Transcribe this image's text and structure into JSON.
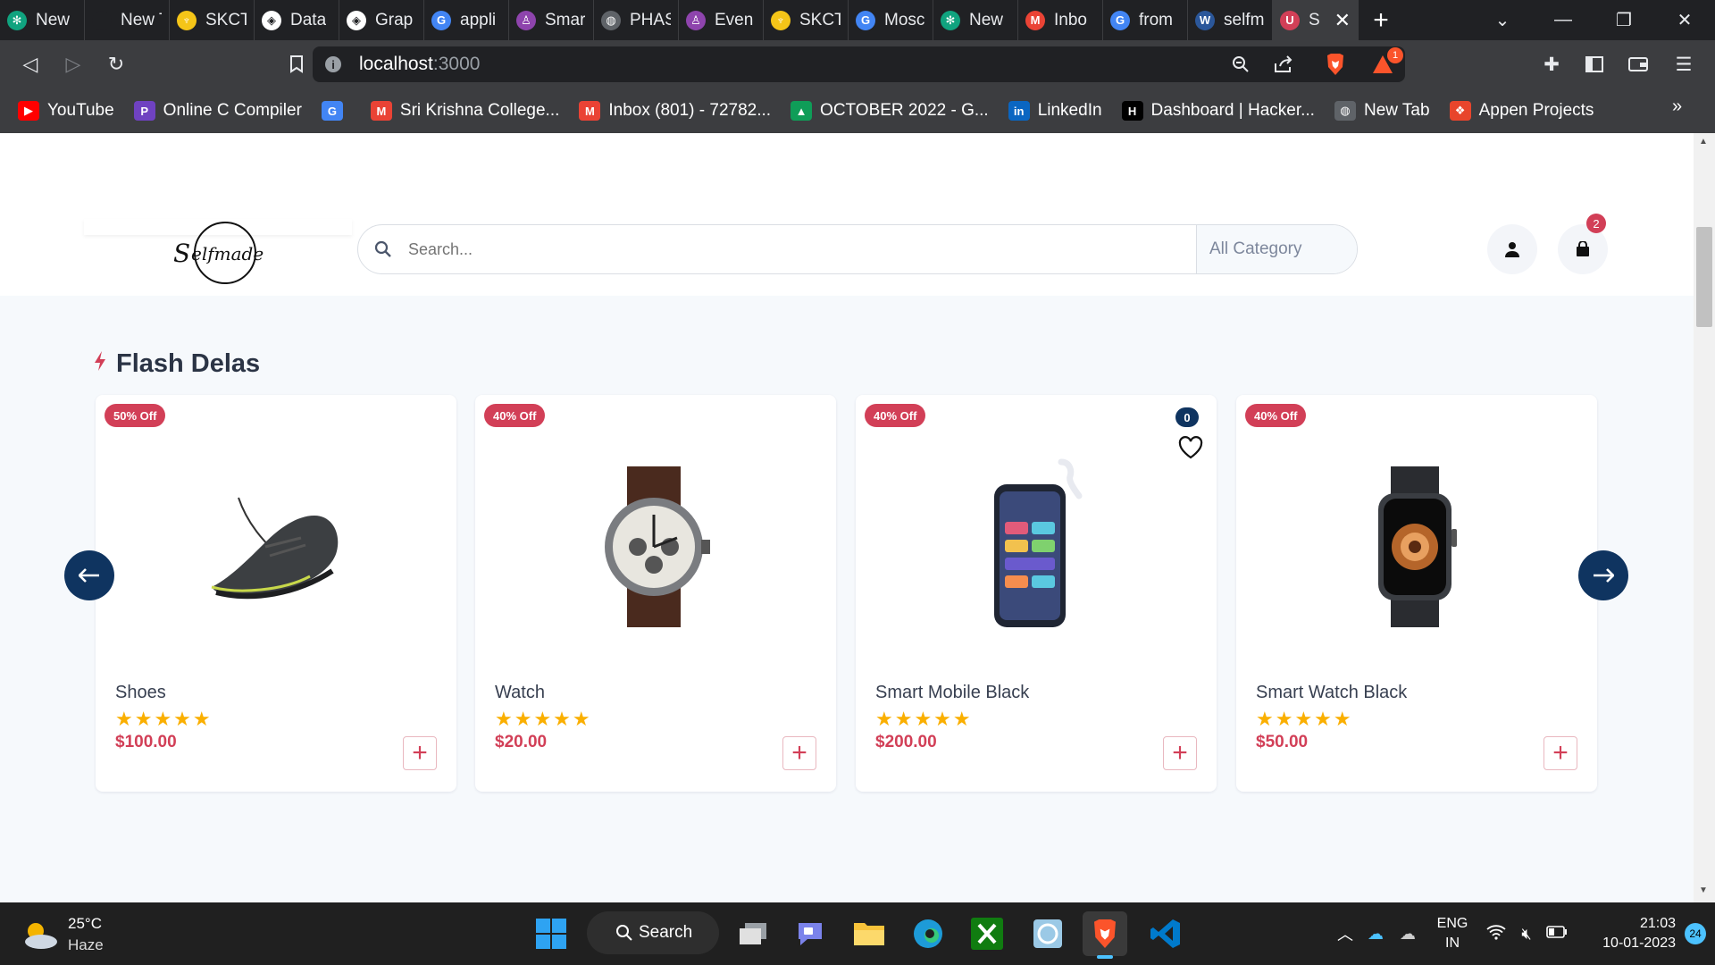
{
  "browser": {
    "tabs": [
      {
        "label": "New",
        "fav": "#10a37f",
        "glyph": "✻"
      },
      {
        "label": "New Tab",
        "fav": "#202124",
        "glyph": ""
      },
      {
        "label": "SKCT",
        "fav": "#f5c518",
        "glyph": "♆"
      },
      {
        "label": "Data",
        "fav": "#ffffff",
        "glyph": "◈"
      },
      {
        "label": "Grap",
        "fav": "#ffffff",
        "glyph": "◈"
      },
      {
        "label": "appli",
        "fav": "#4285f4",
        "glyph": "G"
      },
      {
        "label": "Smar",
        "fav": "#8e44ad",
        "glyph": "♙"
      },
      {
        "label": "PHAS",
        "fav": "#5f6368",
        "glyph": "◍"
      },
      {
        "label": "Even",
        "fav": "#8e44ad",
        "glyph": "♙"
      },
      {
        "label": "SKCT",
        "fav": "#f5c518",
        "glyph": "♆"
      },
      {
        "label": "Mosc",
        "fav": "#4285f4",
        "glyph": "G"
      },
      {
        "label": "New",
        "fav": "#10a37f",
        "glyph": "✻"
      },
      {
        "label": "Inbo",
        "fav": "#ea4335",
        "glyph": "M"
      },
      {
        "label": "from",
        "fav": "#4285f4",
        "glyph": "G"
      },
      {
        "label": "selfm",
        "fav": "#2b579a",
        "glyph": "W"
      },
      {
        "label": "S",
        "fav": "#d23f57",
        "glyph": "U",
        "active": true
      }
    ],
    "url_host": "localhost",
    "url_port": ":3000",
    "brave_alert_count": "1",
    "bookmarks": [
      {
        "label": "YouTube",
        "fav": "#ff0000",
        "glyph": "▶"
      },
      {
        "label": "Online C Compiler",
        "fav": "#6f42c1",
        "glyph": "P"
      },
      {
        "label": "",
        "fav": "#4285f4",
        "glyph": "G"
      },
      {
        "label": "Sri Krishna College...",
        "fav": "#ea4335",
        "glyph": "M"
      },
      {
        "label": "Inbox (801) - 72782...",
        "fav": "#ea4335",
        "glyph": "M"
      },
      {
        "label": "OCTOBER 2022 - G...",
        "fav": "#0f9d58",
        "glyph": "▲"
      },
      {
        "label": "LinkedIn",
        "fav": "#0a66c2",
        "glyph": "in"
      },
      {
        "label": "Dashboard | Hacker...",
        "fav": "#000000",
        "glyph": "H"
      },
      {
        "label": "New Tab",
        "fav": "#5f6368",
        "glyph": "◍"
      },
      {
        "label": "Appen Projects",
        "fav": "#e8452c",
        "glyph": "❖"
      }
    ]
  },
  "site": {
    "search_placeholder": "Search...",
    "category_label": "All Category",
    "cart_count": "2",
    "section_title": "Flash Delas",
    "products": [
      {
        "name": "Shoes",
        "discount": "50% Off",
        "price": "$100.00",
        "rating": 5,
        "image": "shoe"
      },
      {
        "name": "Watch",
        "discount": "40% Off",
        "price": "$20.00",
        "rating": 5,
        "image": "watch"
      },
      {
        "name": "Smart Mobile Black",
        "discount": "40% Off",
        "price": "$200.00",
        "rating": 5,
        "image": "phone",
        "wishlist_count": "0"
      },
      {
        "name": "Smart Watch Black",
        "discount": "40% Off",
        "price": "$50.00",
        "rating": 5,
        "image": "smartwatch"
      }
    ]
  },
  "taskbar": {
    "temperature": "25°C",
    "weather": "Haze",
    "search_label": "Search",
    "language": "ENG",
    "region": "IN",
    "time": "21:03",
    "date": "10-01-2023",
    "notification_count": "24"
  }
}
